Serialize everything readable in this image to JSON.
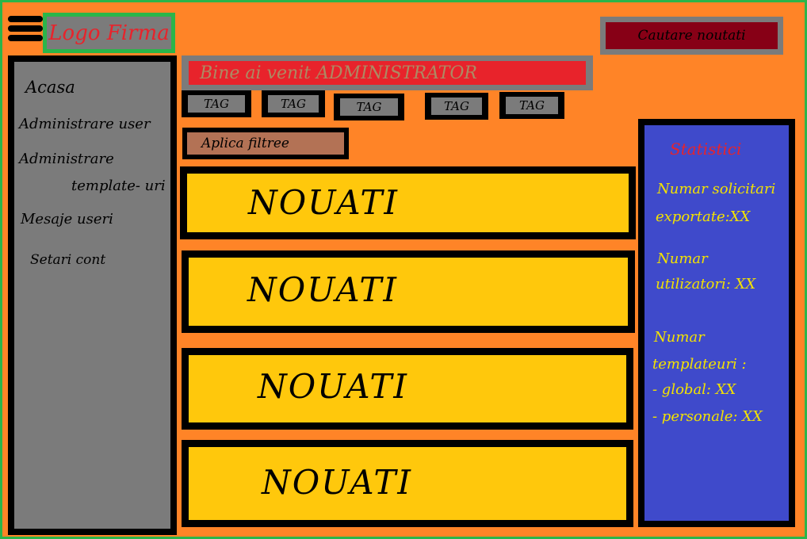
{
  "header": {
    "menu_icon": "hamburger-menu-icon",
    "logo_text": "Logo Firma",
    "search_button_label": "Cautare noutati"
  },
  "sidebar": {
    "items": [
      {
        "label": "Acasa"
      },
      {
        "label": "Administrare user"
      },
      {
        "label_line1": "Administrare",
        "label_line2": "template- uri"
      },
      {
        "label": "Mesaje useri"
      },
      {
        "label": "Setari cont"
      }
    ]
  },
  "main": {
    "welcome_text": "Bine ai venit ADMINISTRATOR",
    "tags": [
      "TAG",
      "TAG",
      "TAG",
      "TAG",
      "TAG"
    ],
    "filter_button_label": "Aplica filtree",
    "news": [
      "NOUATI",
      "NOUATI",
      "NOUATI",
      "NOUATI"
    ]
  },
  "stats": {
    "title": "Statistici",
    "lines": [
      "Numar solicitari",
      "exportate:XX",
      "Numar",
      "utilizatori: XX",
      "Numar",
      "templateuri :",
      "- global: XX",
      "- personale: XX"
    ]
  },
  "colors": {
    "background": "#ff8427",
    "frame": "#2bb54a",
    "panel_gray": "#7b7b7b",
    "news_yellow": "#ffc80c",
    "stats_blue": "#3f4acb",
    "accent_red": "#e8232b",
    "search_dark_red": "#870016",
    "filter_brown": "#b37255",
    "stats_text": "#f3e200"
  }
}
